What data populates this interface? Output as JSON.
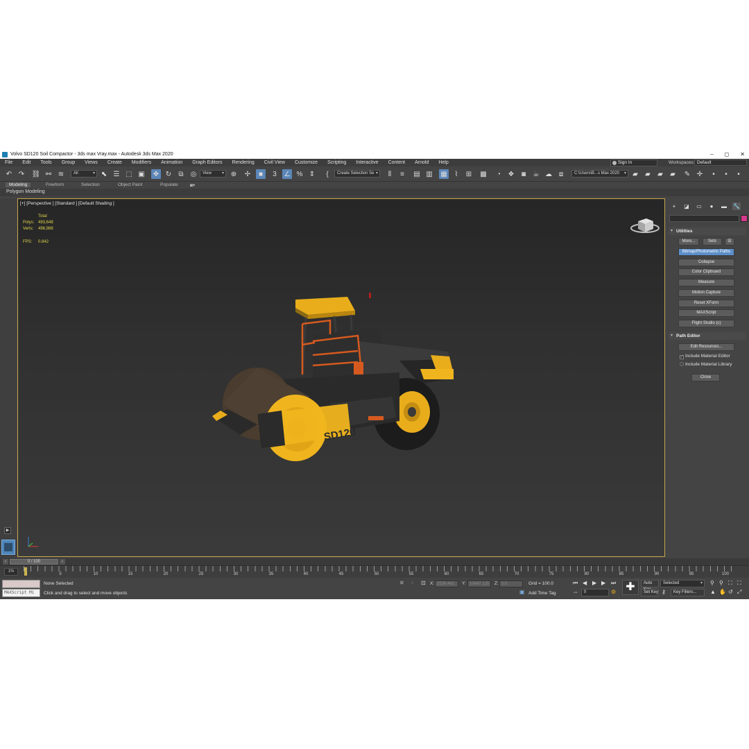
{
  "window": {
    "title": "Volvo SD120 Soil Compactor - 3ds max Vray.max - Autodesk 3ds Max 2020",
    "minimize": "–",
    "maximize": "◻",
    "close": "✕"
  },
  "menu": {
    "items": [
      "File",
      "Edit",
      "Tools",
      "Group",
      "Views",
      "Create",
      "Modifiers",
      "Animation",
      "Graph Editors",
      "Rendering",
      "Civil View",
      "Customize",
      "Scripting",
      "Interactive",
      "Content",
      "Arnold",
      "Help"
    ],
    "sign_in": "Sign In",
    "workspaces_label": "Workspaces:",
    "workspaces_value": "Default"
  },
  "toolbar": {
    "selection_filter": "All",
    "ref_coord": "View",
    "named_selection": "Create Selection Se",
    "project_path": "C:\\Users\\B...s Max 2020",
    "snap_label": "3"
  },
  "ribbon": {
    "tabs": [
      "Modeling",
      "Freeform",
      "Selection",
      "Object Paint",
      "Populate"
    ],
    "active_tab": "Modeling",
    "sub_label": "Polygon Modeling"
  },
  "viewport": {
    "label": "[+] [Perspective ] [Standard ] [Default Shading ]",
    "stats_header": "Total",
    "polys_label": "Polys:",
    "polys_value": "493,648",
    "verts_label": "Verts:",
    "verts_value": "496,988",
    "fps_label": "FPS:",
    "fps_value": "0.842",
    "model_badge": "SD120"
  },
  "command_panel": {
    "utilities_title": "Utilities",
    "more_button": "More...",
    "sets_button": "Sets",
    "utility_buttons": [
      "Bitmap/Photometric Paths",
      "Collapse",
      "Color Clipboard",
      "Measure",
      "Motion Capture",
      "Reset XForm",
      "MAXScript",
      "Flight Studio (c)"
    ],
    "active_utility": "Bitmap/Photometric Paths",
    "path_editor_title": "Path Editor",
    "edit_resources_button": "Edit Resources...",
    "include_material_editor": "Include Material Editor",
    "include_material_library": "Include Material Library",
    "close_button": "Close"
  },
  "timeline": {
    "slider_label": "0 / 100",
    "range_button": "1%",
    "tick_labels": [
      "5",
      "10",
      "15",
      "20",
      "25",
      "30",
      "35",
      "40",
      "45",
      "50",
      "55",
      "60",
      "65",
      "70",
      "75",
      "80",
      "85",
      "90",
      "95",
      "100"
    ]
  },
  "status": {
    "maxscript_placeholder": "MAXScript Mi",
    "selection_status": "None Selected",
    "prompt": "Click and drag to select and move objects",
    "x_label": "X:",
    "x_value": "2538.462",
    "y_label": "Y:",
    "y_value": "10847.125",
    "z_label": "Z:",
    "z_value": "0.0",
    "grid": "Grid = 100.0",
    "add_time_tag": "Add Time Tag",
    "auto_key": "Auto Key",
    "set_key": "Set Key",
    "key_mode": "Selected",
    "key_filters": "Key Filters...",
    "frame_value": "0"
  }
}
